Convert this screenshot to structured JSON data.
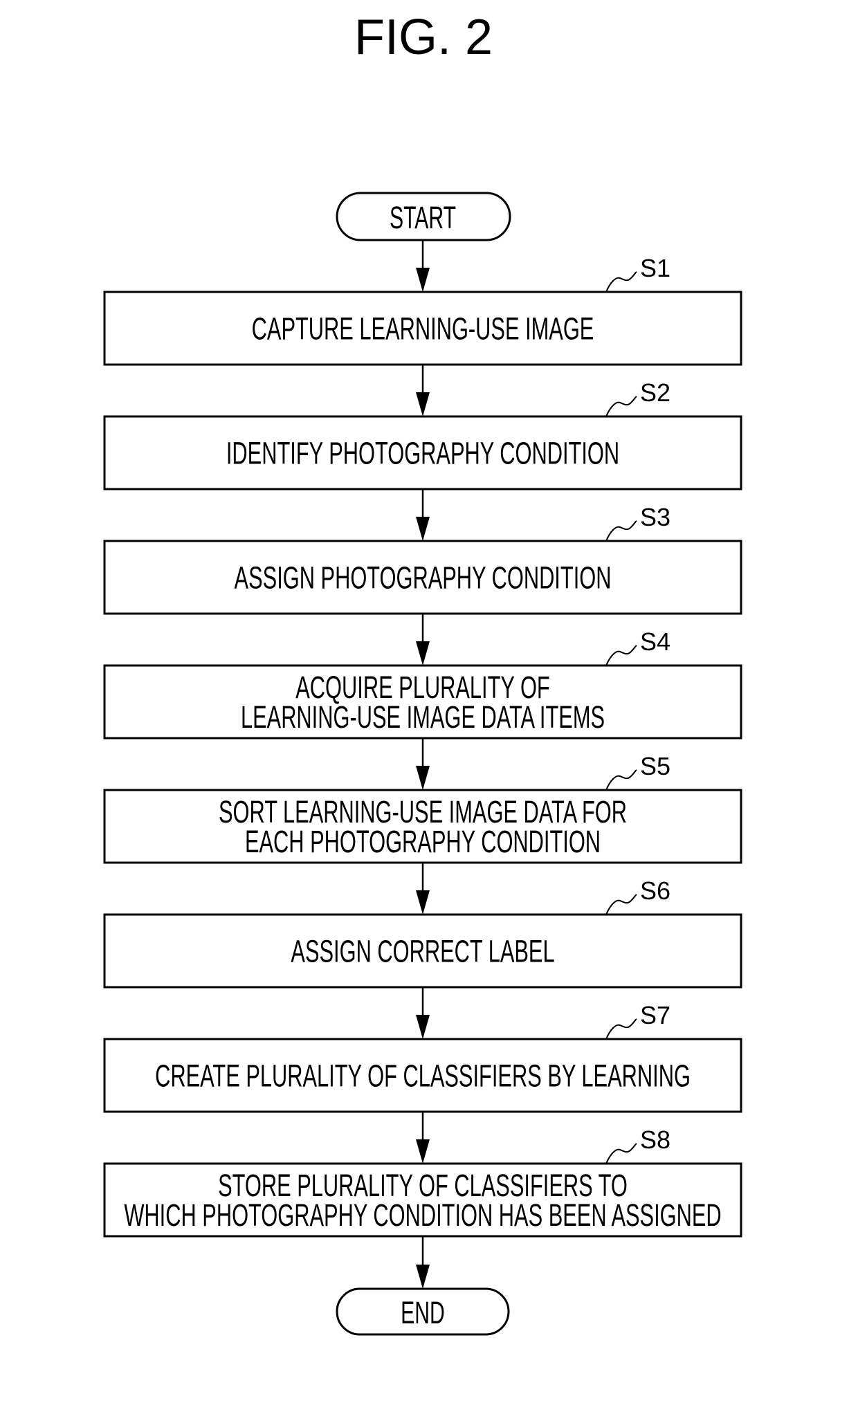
{
  "figure": {
    "title": "FIG. 2"
  },
  "start": {
    "label": "START"
  },
  "end": {
    "label": "END"
  },
  "steps": [
    {
      "id": "S1",
      "lines": [
        "CAPTURE LEARNING-USE IMAGE"
      ]
    },
    {
      "id": "S2",
      "lines": [
        "IDENTIFY PHOTOGRAPHY CONDITION"
      ]
    },
    {
      "id": "S3",
      "lines": [
        "ASSIGN PHOTOGRAPHY CONDITION"
      ]
    },
    {
      "id": "S4",
      "lines": [
        "ACQUIRE PLURALITY OF",
        "LEARNING-USE IMAGE DATA ITEMS"
      ]
    },
    {
      "id": "S5",
      "lines": [
        "SORT LEARNING-USE IMAGE DATA FOR",
        "EACH PHOTOGRAPHY CONDITION"
      ]
    },
    {
      "id": "S6",
      "lines": [
        "ASSIGN CORRECT LABEL"
      ]
    },
    {
      "id": "S7",
      "lines": [
        "CREATE PLURALITY OF CLASSIFIERS BY LEARNING"
      ]
    },
    {
      "id": "S8",
      "lines": [
        "STORE PLURALITY OF CLASSIFIERS TO",
        "WHICH PHOTOGRAPHY CONDITION HAS BEEN ASSIGNED"
      ]
    }
  ],
  "colors": {
    "stroke": "#000000",
    "background": "#ffffff"
  }
}
